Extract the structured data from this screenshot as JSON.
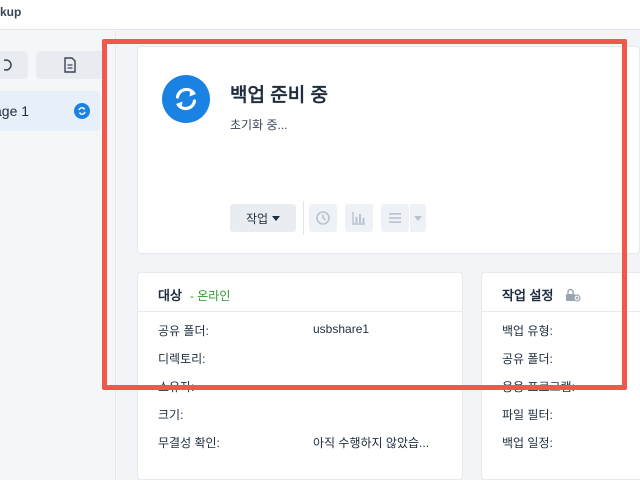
{
  "window": {
    "title_fragment": "kup"
  },
  "sidebar": {
    "task": {
      "label": "age 1"
    }
  },
  "status": {
    "title": "백업 준비 중",
    "subtitle": "초기화 중...",
    "action_label": "작업",
    "icon": "sync-icon",
    "accent": "#1a82e2"
  },
  "target_card": {
    "heading": "대상",
    "online_status": "- 온라인",
    "online_color": "#2a9d2a",
    "rows": [
      {
        "label": "공유 폴더:",
        "value": "usbshare1"
      },
      {
        "label": "디렉토리:",
        "value": ""
      },
      {
        "label": "소유자:",
        "value": ""
      },
      {
        "label": "크기:",
        "value": ""
      },
      {
        "label": "무결성 확인:",
        "value": "아직 수행하지 않았습..."
      }
    ]
  },
  "task_card": {
    "heading": "작업 설정",
    "rows": [
      {
        "label": "백업 유형:"
      },
      {
        "label": "공유 폴더:"
      },
      {
        "label": "응용 프로그램:"
      },
      {
        "label": "파일 필터:"
      },
      {
        "label": "백업 일정:"
      }
    ]
  },
  "highlight_color": "#f0584c"
}
